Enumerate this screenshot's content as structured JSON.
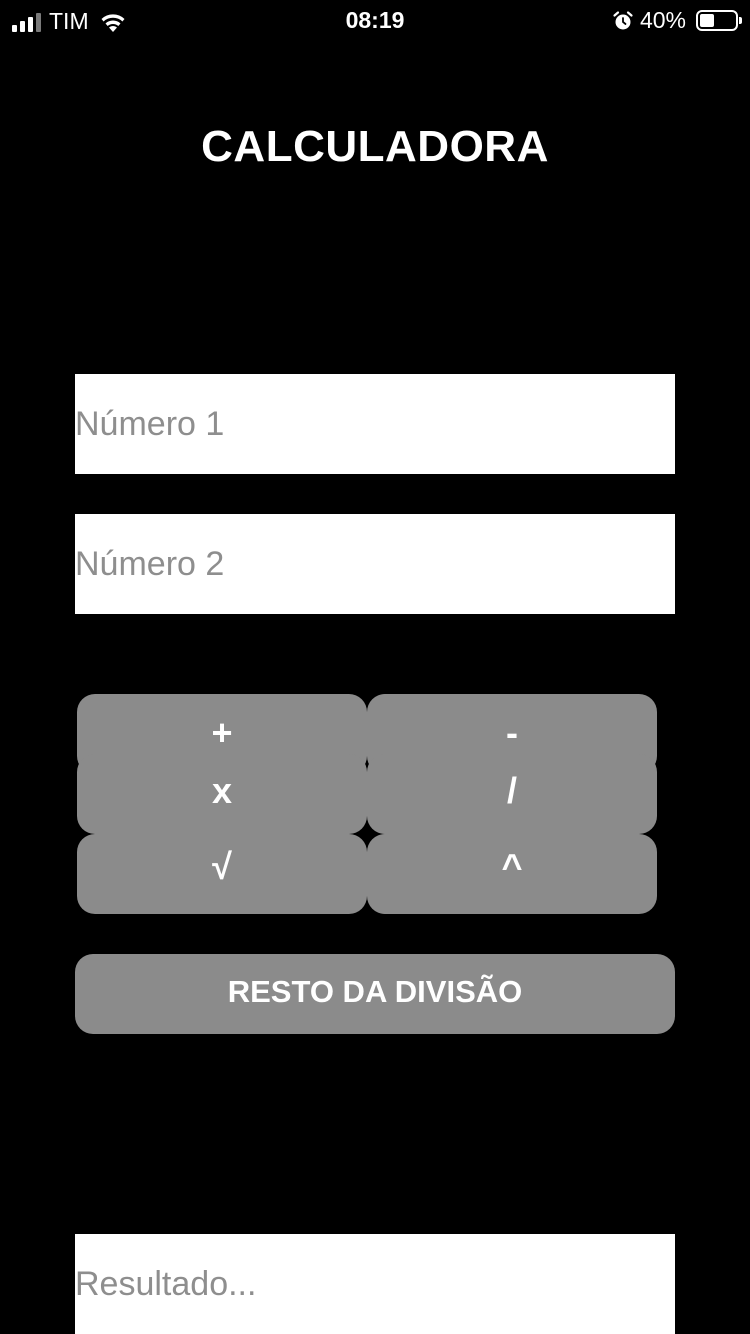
{
  "status_bar": {
    "carrier": "TIM",
    "time": "08:19",
    "battery": "40%",
    "battery_level": 0.4
  },
  "title": "CALCULADORA",
  "inputs": {
    "number1_placeholder": "Número 1",
    "number2_placeholder": "Número 2",
    "result_placeholder": "Resultado..."
  },
  "operators": {
    "add": "+",
    "subtract": "-",
    "multiply": "x",
    "divide": "/",
    "sqrt": "√",
    "power": "^"
  },
  "modulo_label": "RESTO DA DIVISÃO",
  "colors": {
    "background": "#000000",
    "button": "#8b8b8b",
    "field": "#ffffff",
    "placeholder": "#8e8e8e"
  },
  "icons": {
    "signal": "signal-icon",
    "wifi": "wifi-icon",
    "alarm": "alarm-icon",
    "battery": "battery-icon"
  }
}
